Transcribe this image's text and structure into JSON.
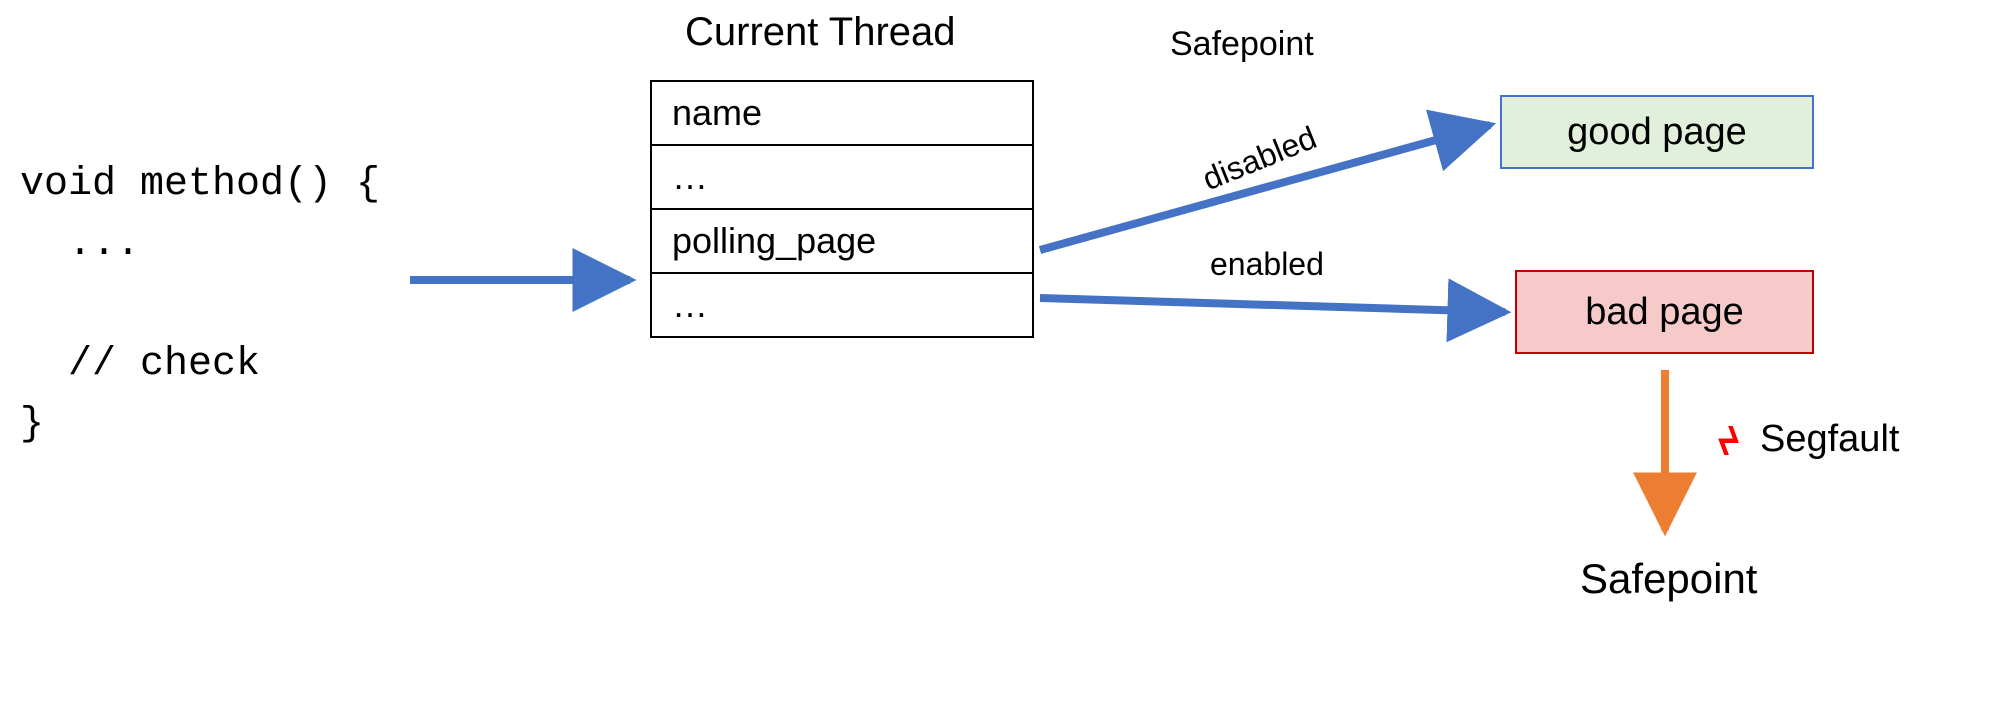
{
  "code": {
    "line1": "void method() {",
    "line2": "  ...",
    "line3": "",
    "line4": "  // check",
    "line5": "}"
  },
  "thread": {
    "title": "Current Thread",
    "rows": [
      "name",
      "…",
      "polling_page",
      "…"
    ]
  },
  "labels": {
    "safepoint_top": "Safepoint",
    "disabled": "disabled",
    "enabled": "enabled",
    "segfault": "Segfault",
    "safepoint_bottom": "Safepoint"
  },
  "pages": {
    "good": "good page",
    "bad": "bad page"
  },
  "icons": {
    "lightning": "ϟ"
  },
  "colors": {
    "arrow_blue": "#4472c4",
    "arrow_orange": "#ed7d31",
    "good_fill": "#e2efda",
    "good_border": "#4472c4",
    "bad_fill": "#f7caca",
    "bad_border": "#c00000",
    "lightning": "#ff0000"
  }
}
